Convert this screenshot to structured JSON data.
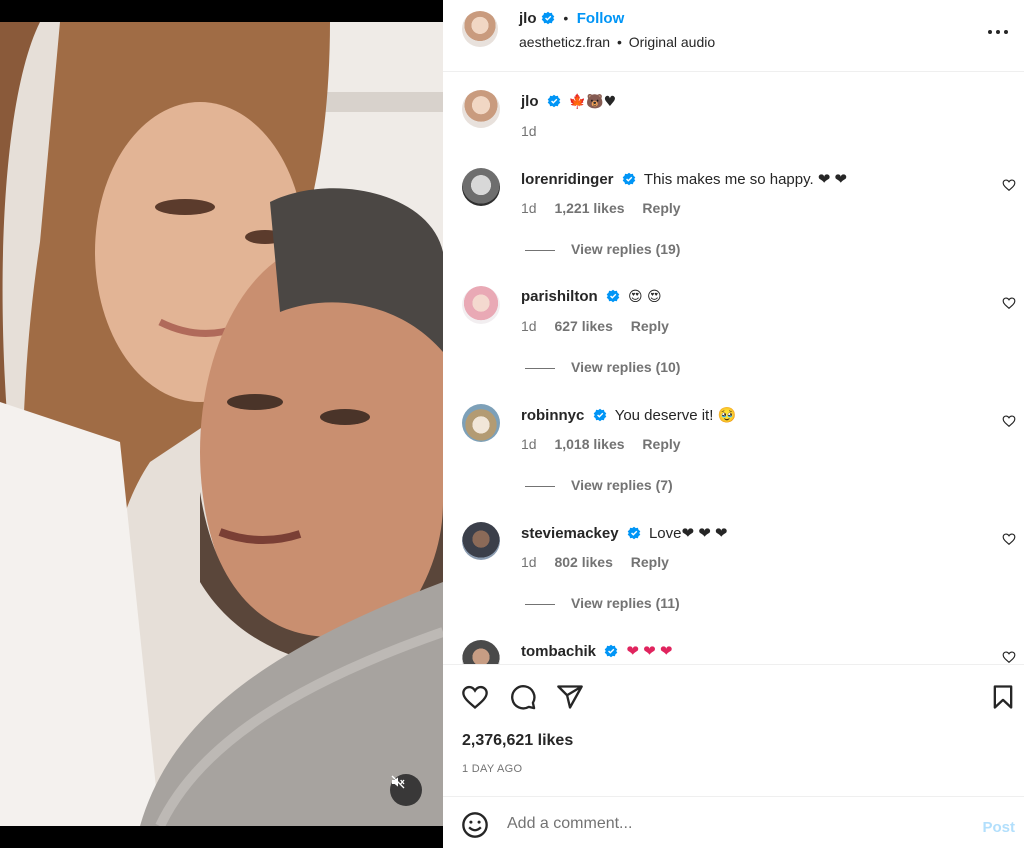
{
  "header": {
    "username": "jlo",
    "separator": "•",
    "follow_label": "Follow",
    "audio_user": "aestheticz.fran",
    "audio_separator": "•",
    "audio_label": "Original audio"
  },
  "caption": {
    "username": "jlo",
    "text": "🍁🐻♥",
    "time": "1d"
  },
  "comments": [
    {
      "username": "lorenridinger",
      "text": "This makes me so happy. ❤ ❤",
      "time": "1d",
      "likes": "1,221 likes",
      "reply_label": "Reply",
      "view_replies": "View replies (19)"
    },
    {
      "username": "parishilton",
      "text": "😍 😍",
      "time": "1d",
      "likes": "627 likes",
      "reply_label": "Reply",
      "view_replies": "View replies (10)"
    },
    {
      "username": "robinnyc",
      "text": "You deserve it! 🥹",
      "time": "1d",
      "likes": "1,018 likes",
      "reply_label": "Reply",
      "view_replies": "View replies (7)"
    },
    {
      "username": "steviemackey",
      "text": "Love❤ ❤ ❤",
      "time": "1d",
      "likes": "802 likes",
      "reply_label": "Reply",
      "view_replies": "View replies (11)"
    },
    {
      "username": "tombachik",
      "text": "❤ ❤ ❤"
    }
  ],
  "footer": {
    "likes_count": "2,376,621 likes",
    "time_ago": "1 DAY AGO",
    "comment_placeholder": "Add a comment...",
    "post_label": "Post"
  },
  "icons": {
    "verified": "verified-badge-icon",
    "more": "more-options-icon",
    "mute": "sound-off-icon",
    "like": "heart-icon",
    "comment": "comment-icon",
    "share": "share-icon",
    "save": "bookmark-icon",
    "emoji": "emoji-icon"
  },
  "colors": {
    "accent": "#0095f6",
    "post_disabled": "#b2dffc",
    "verified": "#0095f6",
    "heart": "#e0245e"
  }
}
